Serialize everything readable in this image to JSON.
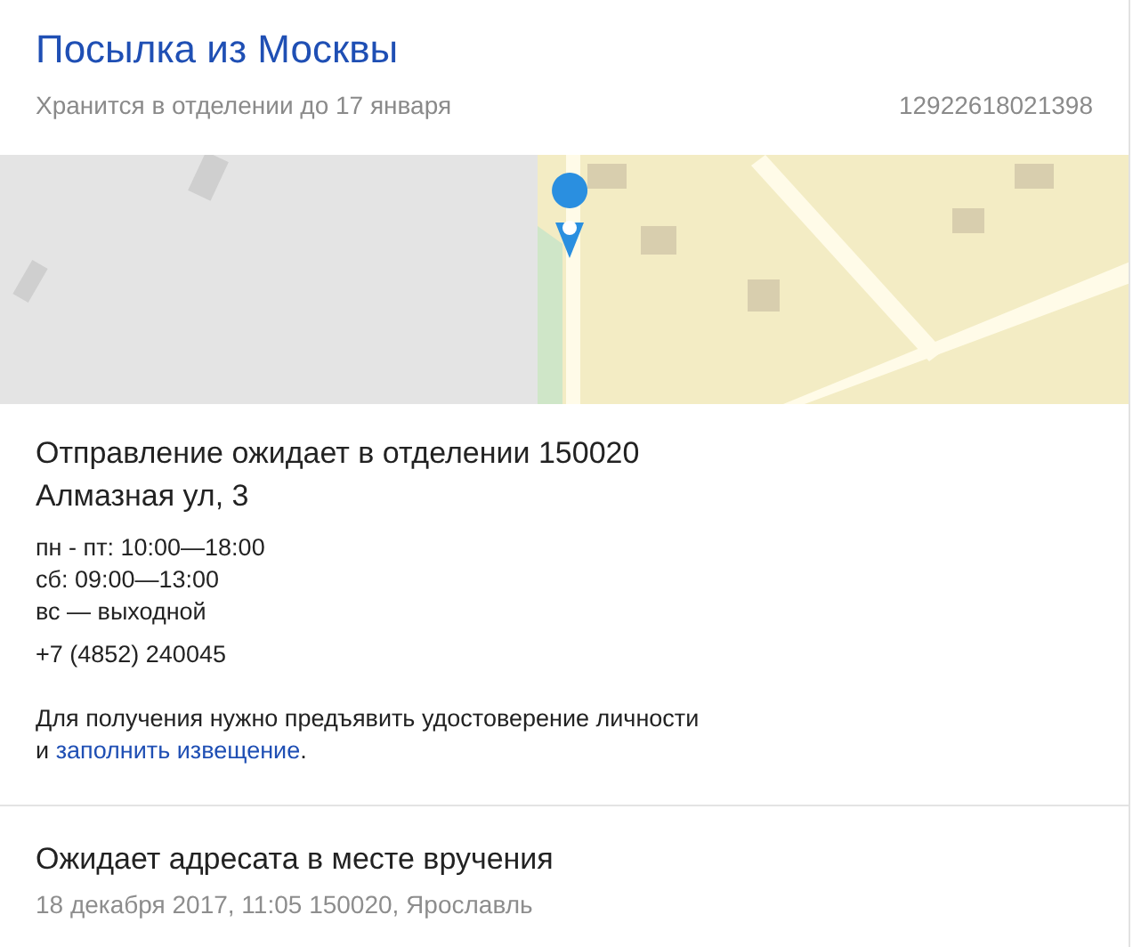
{
  "header": {
    "title": "Посылка из Москвы",
    "subtitle": "Хранится в отделении до 17 января",
    "tracking_number": "12922618021398"
  },
  "office": {
    "title_lines": [
      "Отправление ожидает в отделении 150020",
      "Алмазная ул, 3"
    ],
    "hours": [
      "пн - пт: 10:00—18:00",
      "сб: 09:00—13:00",
      "вс — выходной"
    ],
    "phone": "+7 (4852) 240045",
    "note": {
      "text": "Для получения нужно предъявить удостоверение личности",
      "prefix": "и",
      "link": "заполнить извещение",
      "suffix": "."
    }
  },
  "events": [
    {
      "title": "Ожидает адресата в месте вручения",
      "details": "18 декабря 2017, 11:05 150020, Ярославль"
    }
  ]
}
